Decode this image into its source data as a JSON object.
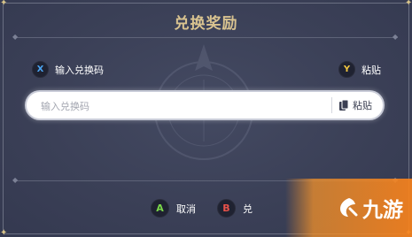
{
  "dialog": {
    "title": "兑换奖励"
  },
  "hints": {
    "input_code": {
      "key": "X",
      "label": "输入兑换码",
      "key_color": "#4aa3f0"
    },
    "paste": {
      "key": "Y",
      "label": "粘贴",
      "key_color": "#f0c541"
    }
  },
  "code_input": {
    "placeholder": "输入兑换码",
    "value": "",
    "paste_label": "粘贴",
    "paste_icon": "clipboard-icon"
  },
  "footer": {
    "cancel": {
      "key": "A",
      "label": "取消",
      "key_color": "#7bd94a"
    },
    "confirm": {
      "key": "B",
      "label": "兑",
      "key_color": "#e8524a"
    }
  },
  "watermark": {
    "logo_icon": "brand-logo-icon",
    "text": "九游"
  },
  "colors": {
    "background": "#3b4057",
    "title": "#d9c390",
    "input_bg": "#ffffff"
  }
}
